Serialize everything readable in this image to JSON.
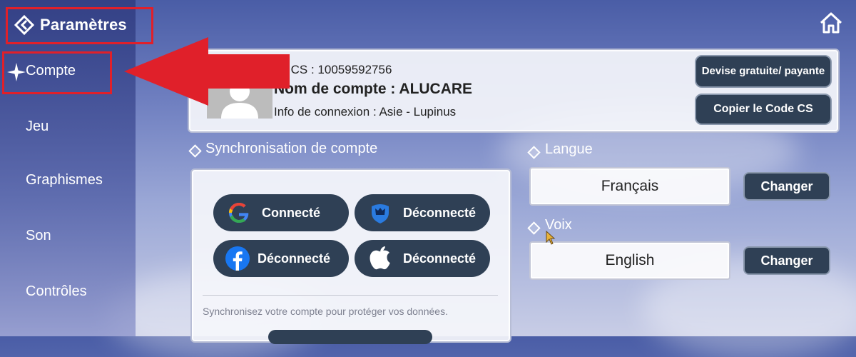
{
  "header": {
    "title": "Paramètres"
  },
  "sidebar": {
    "items": [
      {
        "label": "Compte",
        "active": true
      },
      {
        "label": "Jeu"
      },
      {
        "label": "Graphismes"
      },
      {
        "label": "Son"
      },
      {
        "label": "Contrôles"
      }
    ]
  },
  "account": {
    "cs_code": "de CS : 10059592756",
    "account_name": "Nom de compte : ALUCARE",
    "login_info": "Info de connexion : Asie - Lupinus",
    "currency_button": "Devise gratuite/ payante",
    "copy_code_button": "Copier le Code CS"
  },
  "sync": {
    "title": "Synchronisation de compte",
    "buttons": [
      {
        "icon": "google-icon",
        "label": "Connecté"
      },
      {
        "icon": "shield-logo-icon",
        "label": "Déconnecté"
      },
      {
        "icon": "facebook-icon",
        "label": "Déconnecté"
      },
      {
        "icon": "apple-icon",
        "label": "Déconnecté"
      }
    ],
    "note": "Synchronisez votre compte pour protéger vos données."
  },
  "language": {
    "title": "Langue",
    "value": "Français",
    "change_label": "Changer"
  },
  "voice": {
    "title": "Voix",
    "value": "English",
    "change_label": "Changer"
  },
  "colors": {
    "button_bg": "#2f4055",
    "highlight": "#e0202a"
  }
}
